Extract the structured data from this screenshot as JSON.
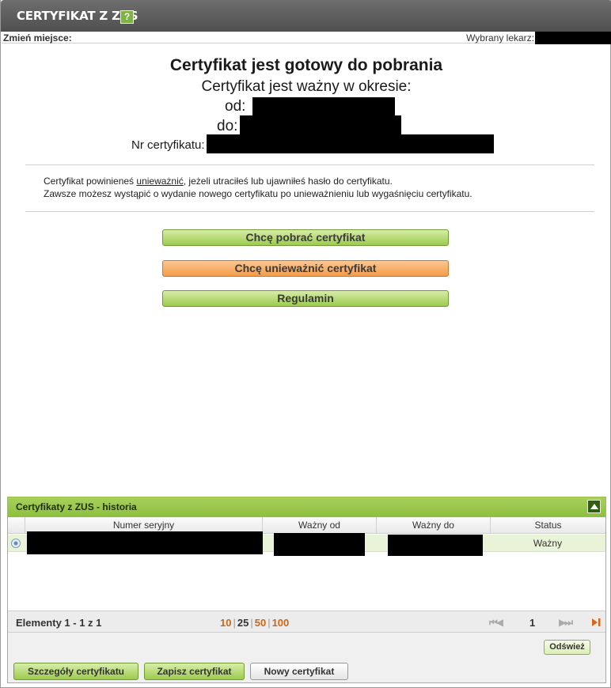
{
  "window": {
    "title": "CERTYFIKAT Z ZUS",
    "help_icon": "?"
  },
  "infobar": {
    "change_place": "Zmień miejsce:",
    "selected_doctor": "Wybrany lekarz:"
  },
  "certificate": {
    "heading": "Certyfikat jest gotowy do pobrania",
    "validity_text": "Certyfikat jest ważny w okresie:",
    "from_label": "od:",
    "to_label": "do:",
    "number_label": "Nr certyfikatu:"
  },
  "note": {
    "line1_prefix": "Certyfikat powinieneś ",
    "line1_link": "unieważnić",
    "line1_suffix": ", jeżeli utraciłeś lub ujawniłeś hasło do certyfikatu.",
    "line2": "Zawsze możesz wystąpić o wydanie nowego certyfikatu po unieważnieniu lub wygaśnięciu certyfikatu."
  },
  "actions": {
    "download": "Chcę pobrać certyfikat",
    "revoke": "Chcę unieważnić certyfikat",
    "terms": "Regulamin"
  },
  "history": {
    "title": "Certyfikaty z ZUS - historia",
    "columns": [
      "Numer seryjny",
      "Ważny od",
      "Ważny do",
      "Status"
    ],
    "rows": [
      {
        "status": "Ważny"
      }
    ],
    "pager": {
      "elements": "Elementy 1 - 1 z 1",
      "sizes": [
        "10",
        "25",
        "50",
        "100"
      ],
      "active_size": "25",
      "page": "1",
      "first_icon": "first-page-icon",
      "prev_icon": "prev-page-icon",
      "next_icon": "next-page-icon",
      "last_icon": "last-page-icon"
    },
    "refresh": "Odśwież",
    "buttons": {
      "details": "Szczegóły certyfikatu",
      "save": "Zapisz certyfikat",
      "new": "Nowy certyfikat"
    }
  },
  "colors": {
    "accent_green": "#9ccb4f",
    "accent_orange": "#f49b4a",
    "title_bar": "#5a5a5a"
  }
}
